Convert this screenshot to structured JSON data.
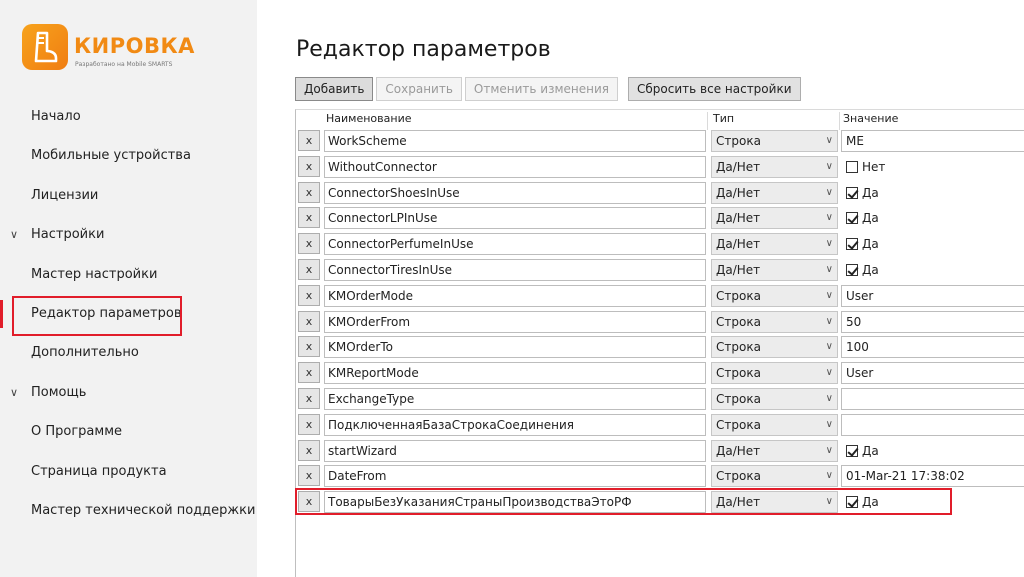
{
  "brand": {
    "name": "КИРОВКА",
    "subtitle": "Разработано на Mobile SMARTS",
    "colors": {
      "brand": "#f18a14",
      "highlight": "#e11d2a"
    }
  },
  "nav": {
    "items": [
      {
        "label": "Начало"
      },
      {
        "label": "Мобильные устройства"
      },
      {
        "label": "Лицензии"
      },
      {
        "label": "Настройки",
        "chevron": "chevron-down-icon",
        "expanded": true
      },
      {
        "label": "Мастер настройки"
      },
      {
        "label": "Редактор параметров",
        "active": true
      },
      {
        "label": "Дополнительно"
      },
      {
        "label": "Помощь",
        "chevron": "chevron-down-icon",
        "expanded": true
      },
      {
        "label": "О Программе"
      },
      {
        "label": "Страница продукта"
      },
      {
        "label": "Мастер технической поддержки"
      }
    ]
  },
  "page": {
    "title": "Редактор параметров"
  },
  "toolbar": {
    "add": "Добавить",
    "save": "Сохранить",
    "cancel": "Отменить изменения",
    "reset": "Сбросить все настройки"
  },
  "grid": {
    "headers": {
      "name": "Наименование",
      "type": "Тип",
      "value": "Значение"
    },
    "delete_label": "x",
    "rows": [
      {
        "name": "WorkScheme",
        "type": "Строка",
        "value": "ME"
      },
      {
        "name": "WithoutConnector",
        "type": "Да/Нет",
        "value": "Нет",
        "checked": false
      },
      {
        "name": "ConnectorShoesInUse",
        "type": "Да/Нет",
        "value": "Да",
        "checked": true
      },
      {
        "name": "ConnectorLPInUse",
        "type": "Да/Нет",
        "value": "Да",
        "checked": true
      },
      {
        "name": "ConnectorPerfumeInUse",
        "type": "Да/Нет",
        "value": "Да",
        "checked": true
      },
      {
        "name": "ConnectorTiresInUse",
        "type": "Да/Нет",
        "value": "Да",
        "checked": true
      },
      {
        "name": "KMOrderMode",
        "type": "Строка",
        "value": "User"
      },
      {
        "name": "KMOrderFrom",
        "type": "Строка",
        "value": "50"
      },
      {
        "name": "KMOrderTo",
        "type": "Строка",
        "value": "100"
      },
      {
        "name": "KMReportMode",
        "type": "Строка",
        "value": "User"
      },
      {
        "name": "ExchangeType",
        "type": "Строка",
        "value": ""
      },
      {
        "name": "ПодключеннаяБазаСтрокаСоединения",
        "type": "Строка",
        "value": ""
      },
      {
        "name": "startWizard",
        "type": "Да/Нет",
        "value": "Да",
        "checked": true
      },
      {
        "name": "DateFrom",
        "type": "Строка",
        "value": "01-Mar-21 17:38:02"
      },
      {
        "name": "ТоварыБезУказанияСтраныПроизводстваЭтоРФ",
        "type": "Да/Нет",
        "value": "Да",
        "checked": true
      }
    ]
  }
}
